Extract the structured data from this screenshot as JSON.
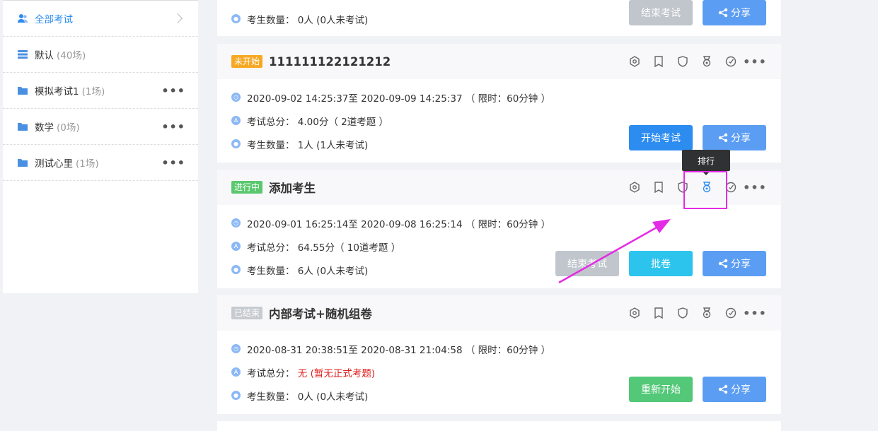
{
  "sidebar": {
    "items": [
      {
        "name": "全部考试",
        "count": "",
        "icon": "users-icon",
        "active": true
      },
      {
        "name": "默认",
        "count": "(40场)",
        "icon": "list-icon"
      },
      {
        "name": "模拟考试1",
        "count": "(1场)",
        "icon": "folder-icon"
      },
      {
        "name": "数学",
        "count": "(0场)",
        "icon": "folder-icon"
      },
      {
        "name": "测试心里",
        "count": "(1场)",
        "icon": "folder-icon"
      }
    ],
    "more_label": "•••"
  },
  "top_card": {
    "count_label": "考生数量：",
    "count_value": "0人 (0人未考试)",
    "btn_end": "结束考试",
    "btn_share": "分享"
  },
  "cards": [
    {
      "status": "未开始",
      "title": "111111122121212",
      "time": "2020-09-02 14:25:37至 2020-09-09 14:25:37 （ 限时：60分钟 ）",
      "score_label": "考试总分：",
      "score": "4.00分（ 2道考题 ）",
      "count_label": "考生数量：",
      "count": "1人 (1人未考试)",
      "btn_primary": "开始考试",
      "btn_share": "分享"
    },
    {
      "status": "进行中",
      "title": "添加考生",
      "time": "2020-09-01 16:25:14至 2020-09-08 16:25:14 （ 限时：60分钟 ）",
      "score_label": "考试总分：",
      "score": "64.55分（ 10道考题 ）",
      "count_label": "考生数量：",
      "count": "6人 (0人未考试)",
      "btn_end": "结束考试",
      "btn_grade": "批卷",
      "btn_share": "分享"
    },
    {
      "status": "已结束",
      "title": "内部考试+随机组卷",
      "time": "2020-08-31 20:38:51至 2020-08-31 21:04:58 （ 限时：60分钟 ）",
      "score_label": "考试总分：",
      "score": "无 (暂无正式考题)",
      "count_label": "考生数量：",
      "count": "0人 (0人未考试)",
      "btn_restart": "重新开始",
      "btn_share": "分享"
    }
  ],
  "tooltip": "排行",
  "colors": {
    "accent": "#2d8cf0",
    "highlight": "#e52ae5",
    "status_pending": "#f7a823",
    "status_running": "#5bc86f",
    "status_ended": "#c7cbd0"
  }
}
